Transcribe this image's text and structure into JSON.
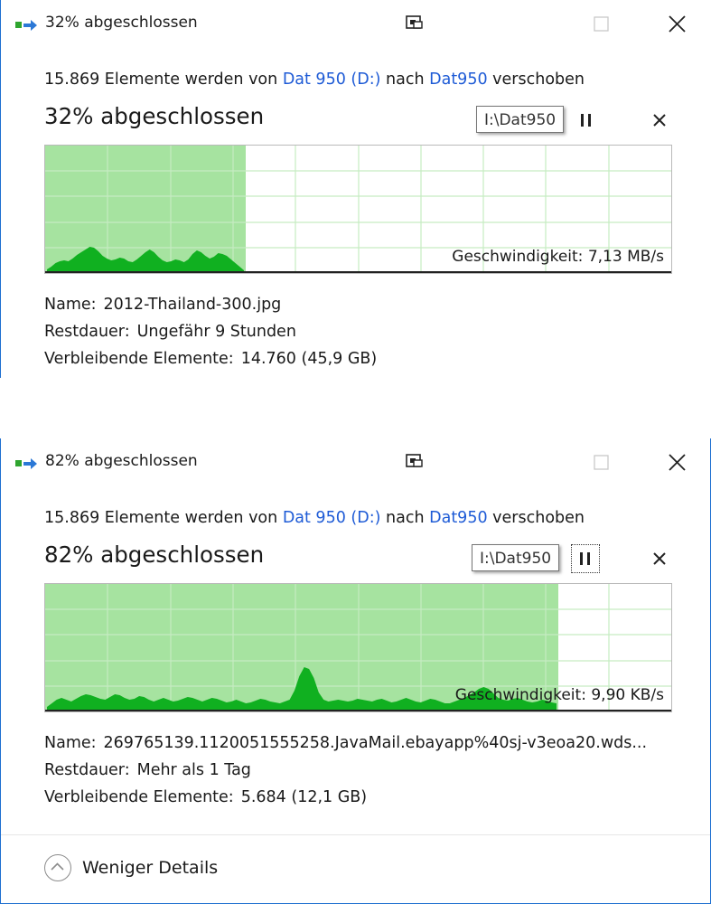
{
  "dialogs": [
    {
      "title": "32% abgeschlossen",
      "description": {
        "prefix": "15.869 Elemente werden von",
        "source": "Dat 950 (D:)",
        "middle": "nach",
        "target": "Dat950",
        "suffix": "verschoben"
      },
      "percent_text": "32% abgeschlossen",
      "progress": 0.32,
      "tooltip": "I:\\Dat950",
      "speed_label": "Geschwindigkeit:",
      "speed_value": "7,13 MB/s",
      "name_label": "Name:",
      "name_value": "2012-Thailand-300.jpg",
      "remaining_time_label": "Restdauer:",
      "remaining_time_value": "Ungefähr 9 Stunden",
      "remaining_items_label": "Verbleibende Elemente:",
      "remaining_items_value": "14.760 (45,9 GB)"
    },
    {
      "title": "82% abgeschlossen",
      "description": {
        "prefix": "15.869 Elemente werden von",
        "source": "Dat 950 (D:)",
        "middle": "nach",
        "target": "Dat950",
        "suffix": "verschoben"
      },
      "percent_text": "82% abgeschlossen",
      "progress": 0.82,
      "tooltip": "I:\\Dat950",
      "speed_label": "Geschwindigkeit:",
      "speed_value": "9,90 KB/s",
      "name_label": "Name:",
      "name_value": "269765139.1120051555258.JavaMail.ebayapp%40sj-v3eoa20.wds...",
      "remaining_time_label": "Restdauer:",
      "remaining_time_value": "Mehr als 1 Tag",
      "remaining_items_label": "Verbleibende Elemente:",
      "remaining_items_value": "5.684 (12,1 GB)",
      "toggle_label": "Weniger Details"
    }
  ],
  "colors": {
    "link": "#1e5bd6",
    "progress_fill": "#a6e3a0",
    "speed_fill": "#10b020",
    "grid": "#c6ecc2"
  },
  "icons": {
    "app": "move-files-icon",
    "restore": "compact-view-icon",
    "maximize": "maximize-icon",
    "close": "close-icon",
    "pause": "pause-icon",
    "cancel": "cancel-icon",
    "toggle": "chevron-up-circle-icon"
  }
}
